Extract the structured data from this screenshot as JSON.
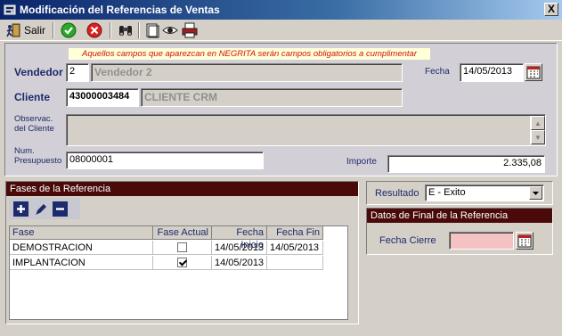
{
  "window": {
    "title": "Modificación del Referencias de Ventas",
    "close_glyph": "X"
  },
  "toolbar": {
    "salir_label": "Salir"
  },
  "notice": "Aquellos campos que aparezcan en NEGRITA serán campos obligatorios a cumplimentar",
  "form": {
    "vendedor_label": "Vendedor",
    "vendedor_code": "2",
    "vendedor_name": "Vendedor 2",
    "fecha_label": "Fecha",
    "fecha_value": "14/05/2013",
    "cliente_label": "Cliente",
    "cliente_code": "43000003484",
    "cliente_name": "CLIENTE CRM",
    "observ_label_1": "Observac.",
    "observ_label_2": "del Cliente",
    "observ_value": "",
    "presupuesto_label_1": "Num.",
    "presupuesto_label_2": "Presupuesto",
    "presupuesto_value": "08000001",
    "importe_label": "Importe",
    "importe_value": "2.335,08"
  },
  "fases": {
    "title": "Fases de la Referencia",
    "columns": [
      "Fase",
      "Fase Actual",
      "Fecha Inicio",
      "Fecha Fin"
    ],
    "rows": [
      {
        "fase": "DEMOSTRACION",
        "actual": false,
        "inicio": "14/05/2013",
        "fin": "14/05/2013"
      },
      {
        "fase": "IMPLANTACION",
        "actual": true,
        "inicio": "14/05/2013",
        "fin": ""
      }
    ]
  },
  "resultado": {
    "label": "Resultado",
    "value": "E - Exito"
  },
  "final": {
    "title": "Datos de Final de la Referencia",
    "fecha_cierre_label": "Fecha Cierre",
    "fecha_cierre_value": ""
  },
  "colors": {
    "title_bar": "#0a246a",
    "section_header": "#4a0a0a",
    "label": "#1d2a6b",
    "notice_text": "#d01010",
    "cierre_field": "#f4c2c2"
  }
}
